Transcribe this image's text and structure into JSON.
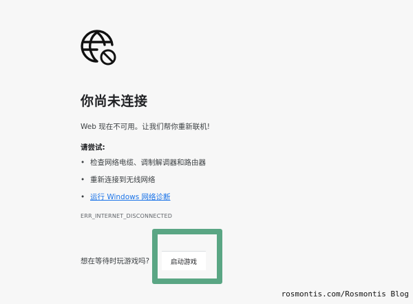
{
  "page": {
    "icon": "globe-blocked-icon",
    "title": "你尚未连接",
    "subtitle": "Web 现在不可用。让我们帮你重新联机!",
    "try_label": "请尝试:",
    "suggestions": [
      {
        "text": "检查网络电缆、调制解调器和路由器",
        "link": false
      },
      {
        "text": "重新连接到无线网络",
        "link": false
      },
      {
        "text": "运行 Windows 网络诊断",
        "link": true
      }
    ],
    "error_code": "ERR_INTERNET_DISCONNECTED",
    "game_prompt": "想在等待时玩游戏吗?",
    "start_game_button": "启动游戏"
  },
  "watermark": "rosmontis.com/Rosmontis Blog",
  "colors": {
    "background": "#f7f7f7",
    "highlight_border": "#5aa684",
    "link": "#1a73e8",
    "text": "#202124"
  }
}
